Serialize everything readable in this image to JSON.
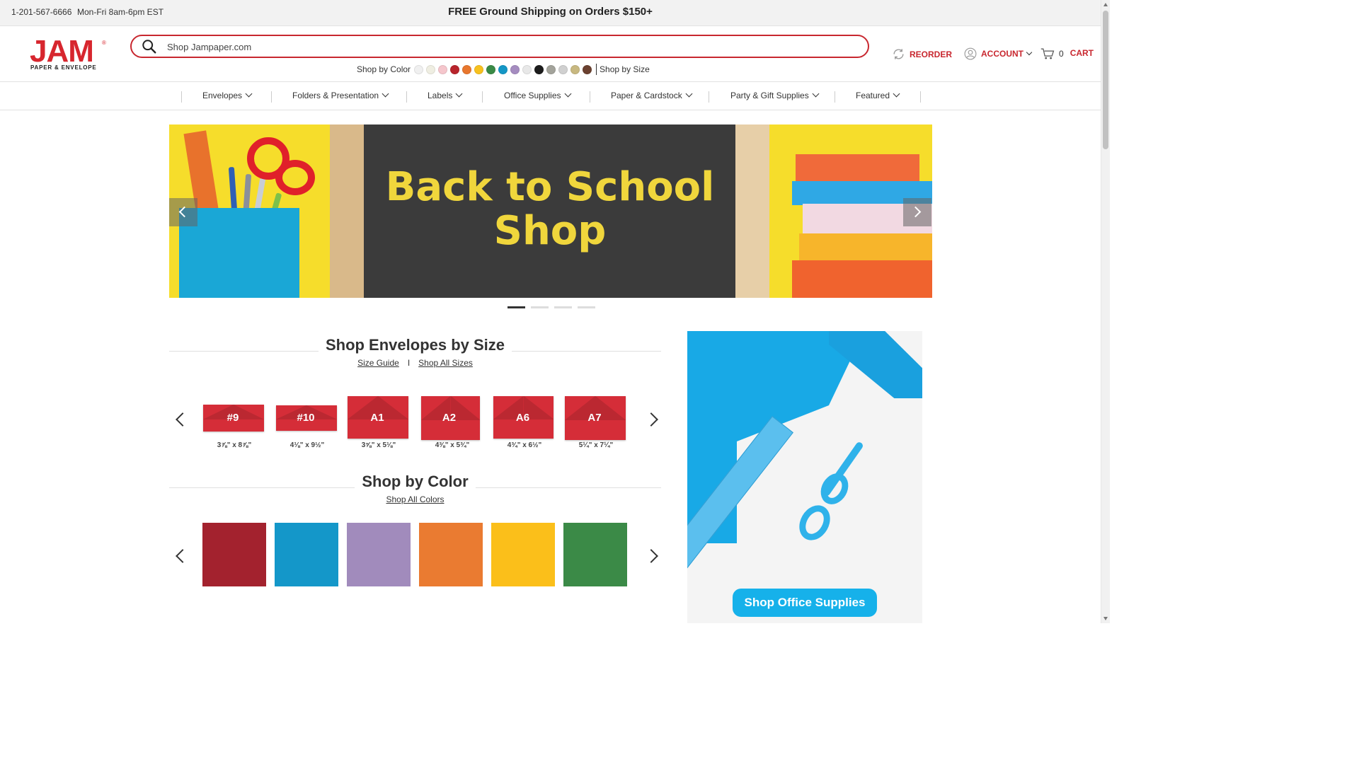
{
  "topbar": {
    "phone": "1-201-567-6666",
    "hours": "Mon-Fri 8am-6pm EST",
    "promo": "FREE Ground Shipping on Orders $150+"
  },
  "logo": {
    "text": "JAM",
    "sub": "PAPER & ENVELOPE"
  },
  "search": {
    "placeholder": "Shop Jampaper.com",
    "value": ""
  },
  "shop_by_color_label": "Shop by Color",
  "shop_by_size_label": "Shop by Size",
  "header_colors": [
    "#f0f0f0",
    "#efeee2",
    "#f5c6cc",
    "#b8242c",
    "#e8772e",
    "#f7c11f",
    "#3a8a46",
    "#1497c6",
    "#a58cc0",
    "#e8e8e8",
    "#1c1c1c",
    "#a3a39b",
    "#d0d0d0",
    "#c8b880",
    "#6b4130"
  ],
  "header_links": {
    "reorder": "REORDER",
    "account": "ACCOUNT",
    "cart_count": "0",
    "cart": "CART"
  },
  "nav": [
    {
      "label": "Envelopes"
    },
    {
      "label": "Folders & Presentation"
    },
    {
      "label": "Labels"
    },
    {
      "label": "Office Supplies"
    },
    {
      "label": "Paper & Cardstock"
    },
    {
      "label": "Party & Gift Supplies"
    },
    {
      "label": "Featured"
    }
  ],
  "hero": {
    "line1": "Back to School",
    "line2": "Shop",
    "slide_count": 4,
    "active_slide": 1
  },
  "envelopes_section": {
    "title": "Shop Envelopes by Size",
    "link1": "Size Guide",
    "separator": "I",
    "link2": "Shop All Sizes",
    "items": [
      {
        "code": "#9",
        "size": "3⅞\" x 8⅞\""
      },
      {
        "code": "#10",
        "size": "4⅛\" x 9½\""
      },
      {
        "code": "A1",
        "size": "3⅝\" x 5⅛\""
      },
      {
        "code": "A2",
        "size": "4⅜\" x 5¾\""
      },
      {
        "code": "A6",
        "size": "4¾\" x 6½\""
      },
      {
        "code": "A7",
        "size": "5¼\" x 7¼\""
      }
    ]
  },
  "color_section": {
    "title": "Shop by Color",
    "link": "Shop All Colors",
    "swatches": [
      "#a3222e",
      "#1497c9",
      "#a18bbc",
      "#ea7b31",
      "#fbbf1a",
      "#3b8a47"
    ]
  },
  "side_promo": {
    "button": "Shop Office Supplies"
  },
  "colors": {
    "brand_red": "#c8272f",
    "promo_blue": "#16b1ea"
  }
}
